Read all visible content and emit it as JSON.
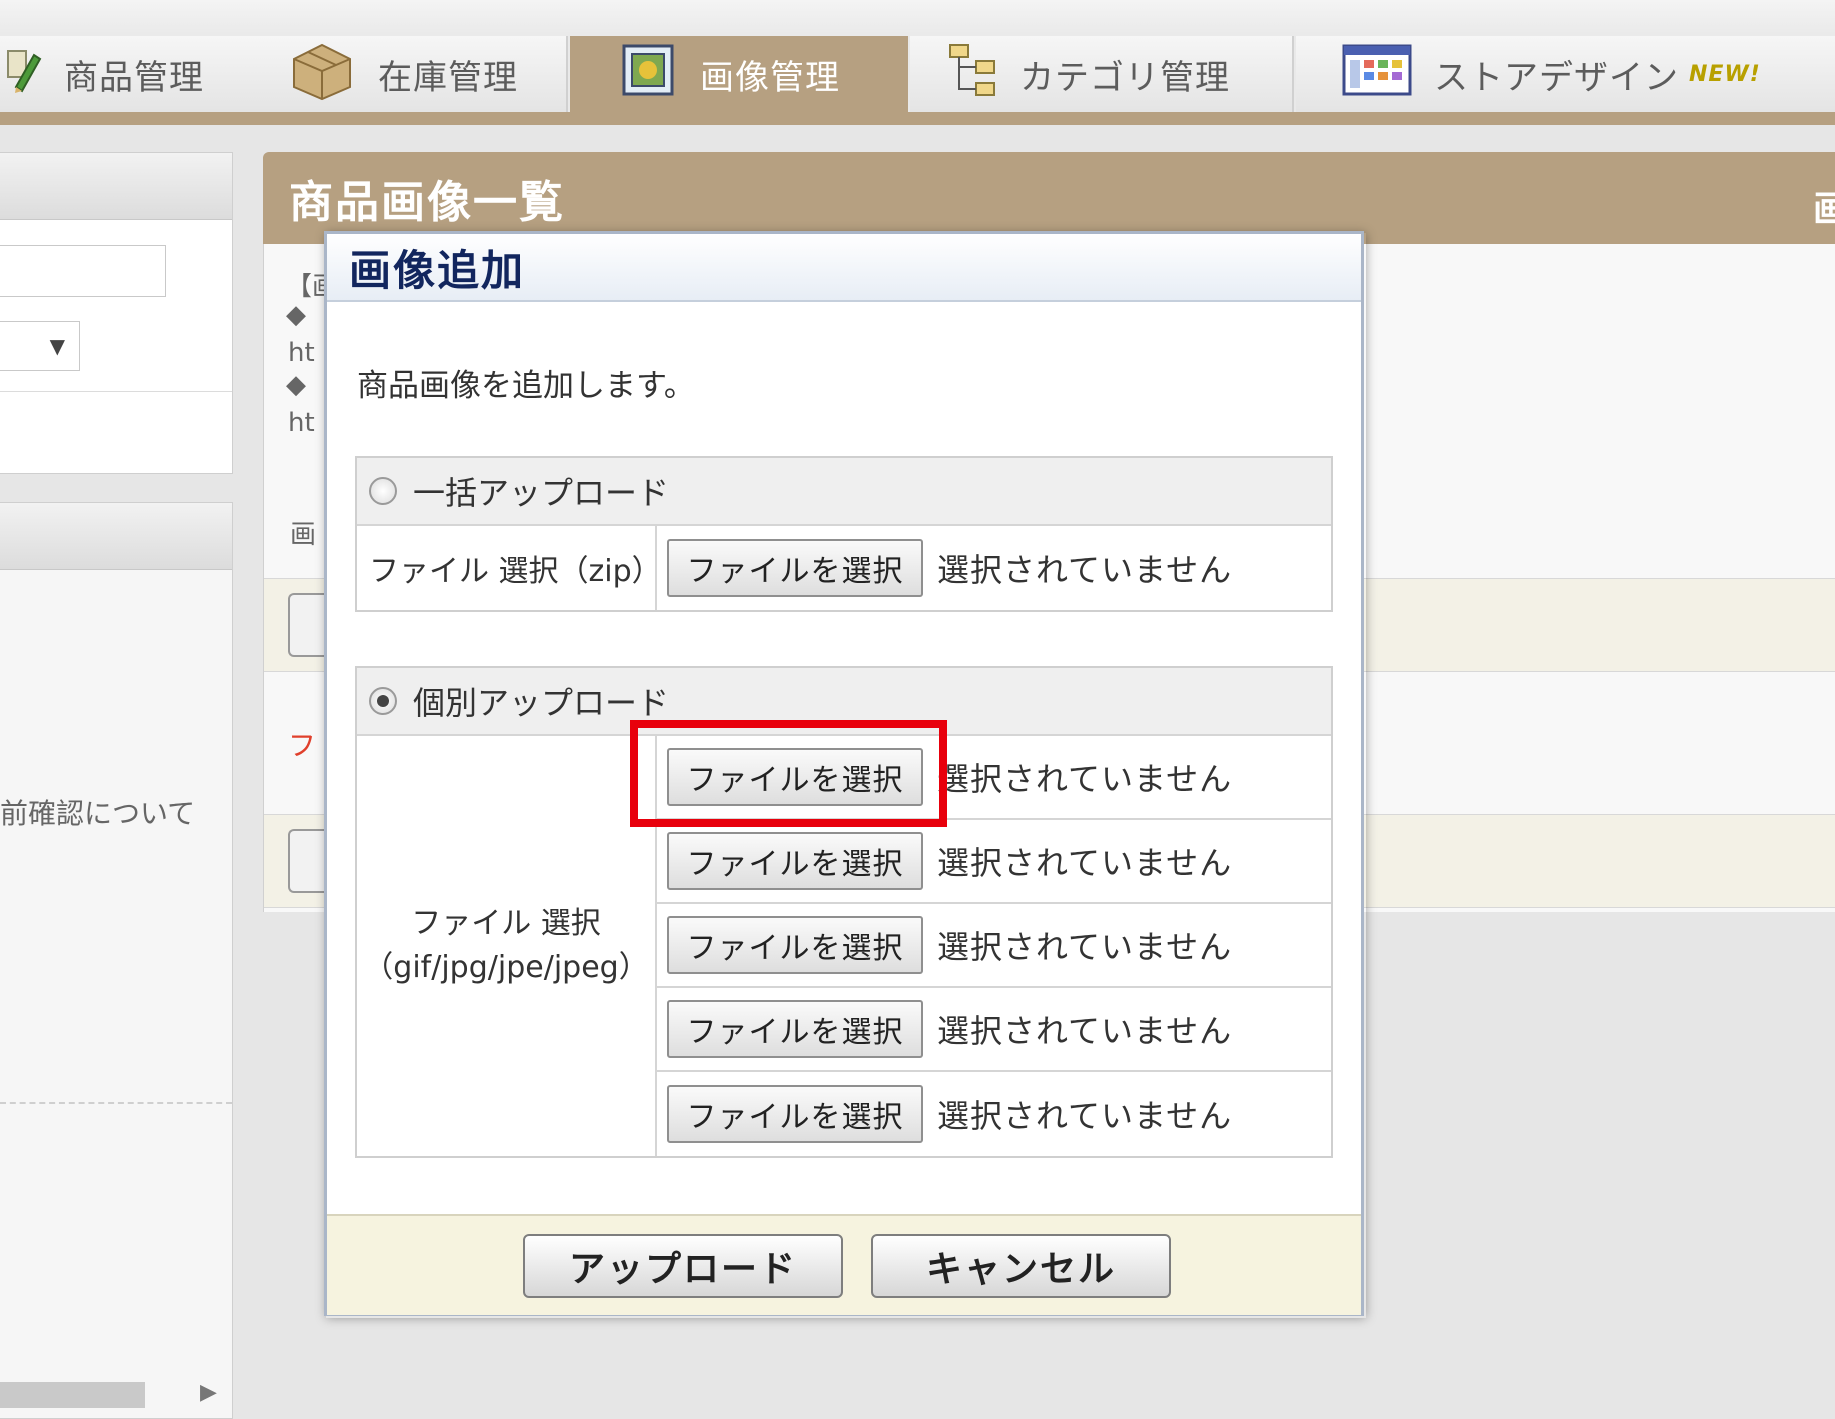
{
  "nav": {
    "tabs": [
      {
        "label": "商品管理",
        "icon": "pencil-icon"
      },
      {
        "label": "在庫管理",
        "icon": "boxes-icon"
      },
      {
        "label": "画像管理",
        "icon": "image-icon",
        "active": true
      },
      {
        "label": "カテゴリ管理",
        "icon": "category-tree-icon"
      },
      {
        "label": "ストアデザイン",
        "icon": "store-design-icon",
        "badge": "NEW!"
      }
    ],
    "active_color": "#b6a081"
  },
  "sidebar": {
    "select_arrow": "▼",
    "partial_text": "前確認について",
    "scroll_arrow": "▶"
  },
  "main": {
    "title": "商品画像一覧",
    "title_right": "画",
    "rows": [
      "【画",
      "◆",
      "ht",
      "◆",
      "ht",
      "画"
    ],
    "red_text": "フ"
  },
  "modal": {
    "title": "画像追加",
    "description": "商品画像を追加します。",
    "bulk": {
      "radio_label": "一括アップロード",
      "checked": false,
      "file_label": "ファイル 選択（zip）",
      "button_label": "ファイルを選択",
      "status": "選択されていません"
    },
    "individual": {
      "radio_label": "個別アップロード",
      "checked": true,
      "file_label_line1": "ファイル 選択",
      "file_label_line2": "（gif/jpg/jpe/jpeg）",
      "files": [
        {
          "button_label": "ファイルを選択",
          "status": "選択されていません"
        },
        {
          "button_label": "ファイルを選択",
          "status": "選択されていません"
        },
        {
          "button_label": "ファイルを選択",
          "status": "選択されていません"
        },
        {
          "button_label": "ファイルを選択",
          "status": "選択されていません"
        },
        {
          "button_label": "ファイルを選択",
          "status": "選択されていません"
        }
      ]
    },
    "upload_button": "アップロード",
    "cancel_button": "キャンセル",
    "highlight_color": "#e8000c"
  }
}
